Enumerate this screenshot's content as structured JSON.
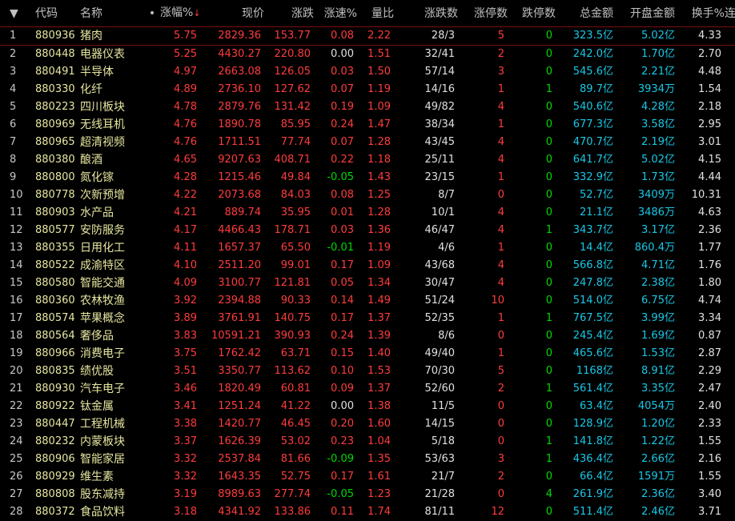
{
  "header": {
    "menu_glyph": "▼",
    "code": "代码",
    "name": "名称",
    "dot": "•",
    "chg_pct": "涨幅%",
    "sort_arrow": "↓",
    "price": "现价",
    "change": "涨跌",
    "speed": "涨速%",
    "vol_ratio": "量比",
    "up_down": "涨跌数",
    "limit_up": "涨停数",
    "limit_down": "跌停数",
    "amount": "总金额",
    "open_amount": "开盘金额",
    "turnover": "换手%",
    "extra": "连涨"
  },
  "rows": [
    {
      "idx": "1",
      "code": "880936",
      "name": "猪肉",
      "pct": "5.75",
      "price": "2829.36",
      "chg": "153.77",
      "speed": "0.08",
      "ratio": "2.22",
      "ud": "28/3",
      "lu": "5",
      "ld": "0",
      "amt": "323.5",
      "amt_unit": "亿",
      "oamt": "5.02",
      "oamt_unit": "亿",
      "turn": "4.33"
    },
    {
      "idx": "2",
      "code": "880448",
      "name": "电器仪表",
      "pct": "5.25",
      "price": "4430.27",
      "chg": "220.80",
      "speed": "0.00",
      "ratio": "1.51",
      "ud": "32/41",
      "lu": "2",
      "ld": "0",
      "amt": "242.0",
      "amt_unit": "亿",
      "oamt": "1.70",
      "oamt_unit": "亿",
      "turn": "2.70"
    },
    {
      "idx": "3",
      "code": "880491",
      "name": "半导体",
      "pct": "4.97",
      "price": "2663.08",
      "chg": "126.05",
      "speed": "0.03",
      "ratio": "1.50",
      "ud": "57/14",
      "lu": "3",
      "ld": "0",
      "amt": "545.6",
      "amt_unit": "亿",
      "oamt": "2.21",
      "oamt_unit": "亿",
      "turn": "4.48"
    },
    {
      "idx": "4",
      "code": "880330",
      "name": "化纤",
      "pct": "4.89",
      "price": "2736.10",
      "chg": "127.62",
      "speed": "0.07",
      "ratio": "1.19",
      "ud": "14/16",
      "lu": "1",
      "ld": "1",
      "amt": "89.7",
      "amt_unit": "亿",
      "oamt": "3934",
      "oamt_unit": "万",
      "turn": "1.54"
    },
    {
      "idx": "5",
      "code": "880223",
      "name": "四川板块",
      "pct": "4.78",
      "price": "2879.76",
      "chg": "131.42",
      "speed": "0.19",
      "ratio": "1.09",
      "ud": "49/82",
      "lu": "4",
      "ld": "0",
      "amt": "540.6",
      "amt_unit": "亿",
      "oamt": "4.28",
      "oamt_unit": "亿",
      "turn": "2.18"
    },
    {
      "idx": "6",
      "code": "880969",
      "name": "无线耳机",
      "pct": "4.76",
      "price": "1890.78",
      "chg": "85.95",
      "speed": "0.24",
      "ratio": "1.47",
      "ud": "38/34",
      "lu": "1",
      "ld": "0",
      "amt": "677.3",
      "amt_unit": "亿",
      "oamt": "3.58",
      "oamt_unit": "亿",
      "turn": "2.95"
    },
    {
      "idx": "7",
      "code": "880965",
      "name": "超清视频",
      "pct": "4.76",
      "price": "1711.51",
      "chg": "77.74",
      "speed": "0.07",
      "ratio": "1.28",
      "ud": "43/45",
      "lu": "4",
      "ld": "0",
      "amt": "470.7",
      "amt_unit": "亿",
      "oamt": "2.19",
      "oamt_unit": "亿",
      "turn": "3.01"
    },
    {
      "idx": "8",
      "code": "880380",
      "name": "酿酒",
      "pct": "4.65",
      "price": "9207.63",
      "chg": "408.71",
      "speed": "0.22",
      "ratio": "1.18",
      "ud": "25/11",
      "lu": "4",
      "ld": "0",
      "amt": "641.7",
      "amt_unit": "亿",
      "oamt": "5.02",
      "oamt_unit": "亿",
      "turn": "4.15"
    },
    {
      "idx": "9",
      "code": "880800",
      "name": "氮化镓",
      "pct": "4.28",
      "price": "1215.46",
      "chg": "49.84",
      "speed": "-0.05",
      "ratio": "1.43",
      "ud": "23/15",
      "lu": "1",
      "ld": "0",
      "amt": "332.9",
      "amt_unit": "亿",
      "oamt": "1.73",
      "oamt_unit": "亿",
      "turn": "4.44"
    },
    {
      "idx": "10",
      "code": "880778",
      "name": "次新预增",
      "pct": "4.22",
      "price": "2073.68",
      "chg": "84.03",
      "speed": "0.08",
      "ratio": "1.25",
      "ud": "8/7",
      "lu": "0",
      "ld": "0",
      "amt": "52.7",
      "amt_unit": "亿",
      "oamt": "3409",
      "oamt_unit": "万",
      "turn": "10.31"
    },
    {
      "idx": "11",
      "code": "880903",
      "name": "水产品",
      "pct": "4.21",
      "price": "889.74",
      "chg": "35.95",
      "speed": "0.01",
      "ratio": "1.28",
      "ud": "10/1",
      "lu": "4",
      "ld": "0",
      "amt": "21.1",
      "amt_unit": "亿",
      "oamt": "3486",
      "oamt_unit": "万",
      "turn": "4.63"
    },
    {
      "idx": "12",
      "code": "880577",
      "name": "安防服务",
      "pct": "4.17",
      "price": "4466.43",
      "chg": "178.71",
      "speed": "0.03",
      "ratio": "1.36",
      "ud": "46/47",
      "lu": "4",
      "ld": "1",
      "amt": "343.7",
      "amt_unit": "亿",
      "oamt": "3.17",
      "oamt_unit": "亿",
      "turn": "2.36"
    },
    {
      "idx": "13",
      "code": "880355",
      "name": "日用化工",
      "pct": "4.11",
      "price": "1657.37",
      "chg": "65.50",
      "speed": "-0.01",
      "ratio": "1.19",
      "ud": "4/6",
      "lu": "1",
      "ld": "0",
      "amt": "14.4",
      "amt_unit": "亿",
      "oamt": "860.4",
      "oamt_unit": "万",
      "turn": "1.77"
    },
    {
      "idx": "14",
      "code": "880522",
      "name": "成渝特区",
      "pct": "4.10",
      "price": "2511.20",
      "chg": "99.01",
      "speed": "0.17",
      "ratio": "1.09",
      "ud": "43/68",
      "lu": "4",
      "ld": "0",
      "amt": "566.8",
      "amt_unit": "亿",
      "oamt": "4.71",
      "oamt_unit": "亿",
      "turn": "1.76"
    },
    {
      "idx": "15",
      "code": "880580",
      "name": "智能交通",
      "pct": "4.09",
      "price": "3100.77",
      "chg": "121.81",
      "speed": "0.05",
      "ratio": "1.34",
      "ud": "30/47",
      "lu": "4",
      "ld": "0",
      "amt": "247.8",
      "amt_unit": "亿",
      "oamt": "2.38",
      "oamt_unit": "亿",
      "turn": "1.80"
    },
    {
      "idx": "16",
      "code": "880360",
      "name": "农林牧渔",
      "pct": "3.92",
      "price": "2394.88",
      "chg": "90.33",
      "speed": "0.14",
      "ratio": "1.49",
      "ud": "51/24",
      "lu": "10",
      "ld": "0",
      "amt": "514.0",
      "amt_unit": "亿",
      "oamt": "6.75",
      "oamt_unit": "亿",
      "turn": "4.74"
    },
    {
      "idx": "17",
      "code": "880574",
      "name": "苹果概念",
      "pct": "3.89",
      "price": "3761.91",
      "chg": "140.75",
      "speed": "0.17",
      "ratio": "1.37",
      "ud": "52/35",
      "lu": "1",
      "ld": "1",
      "amt": "767.5",
      "amt_unit": "亿",
      "oamt": "3.99",
      "oamt_unit": "亿",
      "turn": "3.34"
    },
    {
      "idx": "18",
      "code": "880564",
      "name": "奢侈品",
      "pct": "3.83",
      "price": "10591.21",
      "chg": "390.93",
      "speed": "0.24",
      "ratio": "1.39",
      "ud": "8/6",
      "lu": "0",
      "ld": "0",
      "amt": "245.4",
      "amt_unit": "亿",
      "oamt": "1.69",
      "oamt_unit": "亿",
      "turn": "0.87"
    },
    {
      "idx": "19",
      "code": "880966",
      "name": "消费电子",
      "pct": "3.75",
      "price": "1762.42",
      "chg": "63.71",
      "speed": "0.15",
      "ratio": "1.40",
      "ud": "49/40",
      "lu": "1",
      "ld": "0",
      "amt": "465.6",
      "amt_unit": "亿",
      "oamt": "1.53",
      "oamt_unit": "亿",
      "turn": "2.87"
    },
    {
      "idx": "20",
      "code": "880835",
      "name": "绩优股",
      "pct": "3.51",
      "price": "3350.77",
      "chg": "113.62",
      "speed": "0.10",
      "ratio": "1.53",
      "ud": "70/30",
      "lu": "5",
      "ld": "0",
      "amt": "1168",
      "amt_unit": "亿",
      "oamt": "8.91",
      "oamt_unit": "亿",
      "turn": "2.29"
    },
    {
      "idx": "21",
      "code": "880930",
      "name": "汽车电子",
      "pct": "3.46",
      "price": "1820.49",
      "chg": "60.81",
      "speed": "0.09",
      "ratio": "1.37",
      "ud": "52/60",
      "lu": "2",
      "ld": "1",
      "amt": "561.4",
      "amt_unit": "亿",
      "oamt": "3.35",
      "oamt_unit": "亿",
      "turn": "2.47"
    },
    {
      "idx": "22",
      "code": "880922",
      "name": "钛金属",
      "pct": "3.41",
      "price": "1251.24",
      "chg": "41.22",
      "speed": "0.00",
      "ratio": "1.38",
      "ud": "11/5",
      "lu": "0",
      "ld": "0",
      "amt": "63.4",
      "amt_unit": "亿",
      "oamt": "4054",
      "oamt_unit": "万",
      "turn": "2.40"
    },
    {
      "idx": "23",
      "code": "880447",
      "name": "工程机械",
      "pct": "3.38",
      "price": "1420.77",
      "chg": "46.45",
      "speed": "0.20",
      "ratio": "1.60",
      "ud": "14/15",
      "lu": "0",
      "ld": "0",
      "amt": "128.9",
      "amt_unit": "亿",
      "oamt": "1.20",
      "oamt_unit": "亿",
      "turn": "2.33"
    },
    {
      "idx": "24",
      "code": "880232",
      "name": "内蒙板块",
      "pct": "3.37",
      "price": "1626.39",
      "chg": "53.02",
      "speed": "0.23",
      "ratio": "1.04",
      "ud": "5/18",
      "lu": "0",
      "ld": "1",
      "amt": "141.8",
      "amt_unit": "亿",
      "oamt": "1.22",
      "oamt_unit": "亿",
      "turn": "1.55"
    },
    {
      "idx": "25",
      "code": "880906",
      "name": "智能家居",
      "pct": "3.32",
      "price": "2537.84",
      "chg": "81.66",
      "speed": "-0.09",
      "ratio": "1.35",
      "ud": "53/63",
      "lu": "3",
      "ld": "1",
      "amt": "436.4",
      "amt_unit": "亿",
      "oamt": "2.66",
      "oamt_unit": "亿",
      "turn": "2.16"
    },
    {
      "idx": "26",
      "code": "880929",
      "name": "维生素",
      "pct": "3.32",
      "price": "1643.35",
      "chg": "52.75",
      "speed": "0.17",
      "ratio": "1.61",
      "ud": "21/7",
      "lu": "2",
      "ld": "0",
      "amt": "66.4",
      "amt_unit": "亿",
      "oamt": "1591",
      "oamt_unit": "万",
      "turn": "1.55"
    },
    {
      "idx": "27",
      "code": "880808",
      "name": "股东减持",
      "pct": "3.19",
      "price": "8989.63",
      "chg": "277.74",
      "speed": "-0.05",
      "ratio": "1.23",
      "ud": "21/28",
      "lu": "0",
      "ld": "4",
      "amt": "261.9",
      "amt_unit": "亿",
      "oamt": "2.36",
      "oamt_unit": "亿",
      "turn": "3.40"
    },
    {
      "idx": "28",
      "code": "880372",
      "name": "食品饮料",
      "pct": "3.18",
      "price": "4341.92",
      "chg": "133.86",
      "speed": "0.11",
      "ratio": "1.74",
      "ud": "81/11",
      "lu": "12",
      "ld": "0",
      "amt": "511.4",
      "amt_unit": "亿",
      "oamt": "2.46",
      "oamt_unit": "亿",
      "turn": "3.71"
    }
  ]
}
